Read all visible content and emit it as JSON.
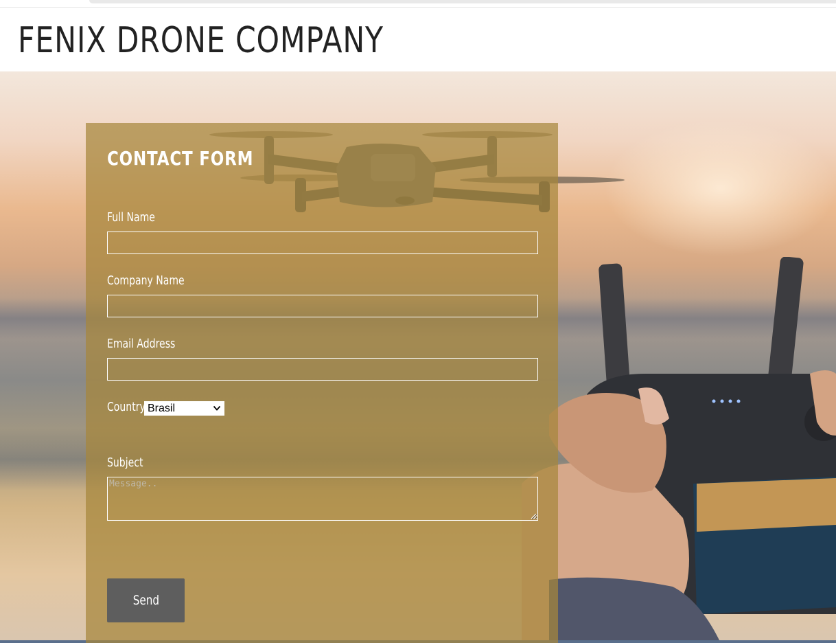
{
  "header": {
    "title": "FENIX DRONE COMPANY"
  },
  "form": {
    "title": "CONTACT FORM",
    "full_name_label": "Full Name",
    "full_name_value": "",
    "company_label": "Company Name",
    "company_value": "",
    "email_label": "Email Address",
    "email_value": "",
    "country_label": "Country",
    "country_selected": "Brasil",
    "subject_label": "Subject",
    "subject_placeholder": "Message..",
    "send_label": "Send"
  },
  "colors": {
    "panel_overlay": "#a6863c",
    "button_bg": "#5e5e5e",
    "title_text": "#222222"
  },
  "icons": {
    "select_arrow": "chevron-down-icon",
    "resize_grip": "resize-grip-icon"
  }
}
